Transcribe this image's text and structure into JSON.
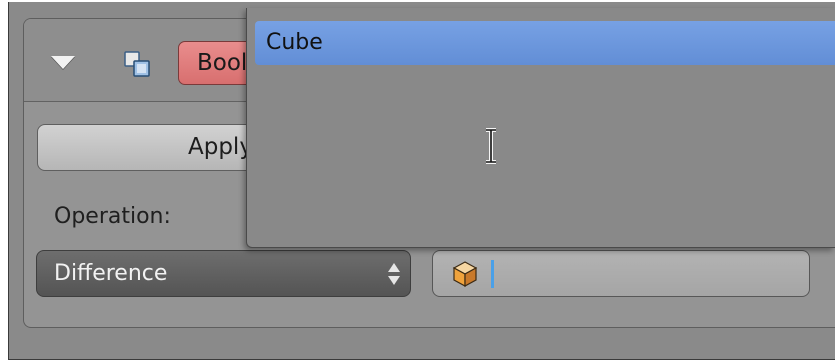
{
  "modifier": {
    "name_value": "Boolean",
    "apply_label": "Apply",
    "operation_label": "Operation:",
    "operation_selected": "Difference",
    "object_value": ""
  },
  "dropdown": {
    "items": [
      {
        "label": "Cube",
        "highlighted": true
      }
    ]
  },
  "icons": {
    "collapse": "triangle-down-icon",
    "modifier_type": "boolean-modifier-icon",
    "operation_select": "up-down-arrows-icon",
    "object": "cube-object-icon",
    "cursor": "text-ibeam-cursor"
  },
  "colors": {
    "name_field": "#d97373",
    "highlight": "#6b96dc",
    "caret": "#4aa0e8",
    "operation_select": "#5e5e5e"
  }
}
